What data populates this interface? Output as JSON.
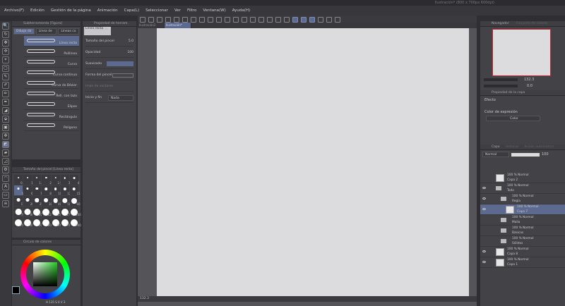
{
  "title": "Ilustración* (800 x 700px 600dpi)",
  "menu": [
    "Archivo(F)",
    "Edición",
    "Gestión de la página",
    "Animación",
    "Capa(L)",
    "Seleccionar",
    "Ver",
    "Filtro",
    "Ventana(W)",
    "Ayuda(H)"
  ],
  "subtool": {
    "header": "Subherramienta [Figura]",
    "tabs": [
      "Dibujo dir",
      "Línea de",
      "Líneas co"
    ],
    "items": [
      "Línea recta",
      "Polilínea",
      "Curva",
      "Curva continua",
      "Curva de Bézier",
      "Rell. con lazo",
      "Elipse",
      "Rectángulo",
      "Polígono"
    ],
    "selected": 0
  },
  "toolprop": {
    "header": "Propiedad de herram. [Línea re",
    "preset": "Línea recta",
    "brush_size_label": "Tamaño del pincel",
    "brush_size": "5.0",
    "opacity_label": "Opacidad",
    "opacity": "100",
    "antialias_label": "Suavizado",
    "shape_label": "Forma del pincel",
    "vector_label": "Imán de vectores",
    "startend_label": "Inicio y fin",
    "startend_value": "Nada"
  },
  "brushsize": {
    "header": "Tamaño del pincel [Línea recta]",
    "sizes": [
      "0.7",
      "1",
      "1.5",
      "2",
      "2.5",
      "3",
      "4",
      "5",
      "6",
      "7",
      "8",
      "10",
      "12",
      "15",
      "17",
      "20",
      "25",
      "30",
      "40",
      "50",
      "60",
      "70",
      "80",
      "100",
      "120",
      "150",
      "170",
      "200",
      "250",
      "300",
      "400",
      "500",
      "600",
      "700",
      "800"
    ],
    "selected": "5"
  },
  "colorwheel": {
    "header": "Círculo de colores",
    "readout": "H 135 S 0 V 3"
  },
  "doc_tabs": [
    "Ilustración2",
    "Ilustración*"
  ],
  "status": {
    "zoom": "132.3"
  },
  "navigator": {
    "tabs": [
      "Navegador",
      "Conjunto de colores"
    ],
    "zoom": "132.3",
    "angle": "0.0"
  },
  "layerprop": {
    "header": "Propiedad de la capa",
    "effect_label": "Efecto",
    "expr_label": "Color de expresión",
    "expr_value": "Color"
  },
  "layers": {
    "tabs": [
      "Capa",
      "Historial",
      "Acción automática"
    ],
    "blend": "Normal",
    "opacity": "100",
    "items": [
      {
        "mode": "100 % Normal",
        "name": "Capa 2",
        "type": "layer",
        "indent": 0,
        "visible": false,
        "selected": false
      },
      {
        "mode": "100 % Normal",
        "name": "Todo",
        "type": "folder",
        "indent": 0,
        "visible": true,
        "selected": false
      },
      {
        "mode": "100 % Normal",
        "name": "Regla",
        "type": "folder",
        "indent": 1,
        "visible": true,
        "selected": false
      },
      {
        "mode": "100 % Normal",
        "name": "Capa 7",
        "type": "layer",
        "indent": 2,
        "visible": true,
        "selected": true
      },
      {
        "mode": "100 % Normal",
        "name": "Malla",
        "type": "folder",
        "indent": 1,
        "visible": false,
        "selected": false
      },
      {
        "mode": "100 % Normal",
        "name": "Básicos",
        "type": "folder",
        "indent": 1,
        "visible": false,
        "selected": false
      },
      {
        "mode": "100 % Normal",
        "name": "Sólidos",
        "type": "folder",
        "indent": 1,
        "visible": false,
        "selected": false
      },
      {
        "mode": "100 % Normal",
        "name": "Capa 8",
        "type": "layer",
        "indent": 0,
        "visible": true,
        "selected": false
      },
      {
        "mode": "100 % Normal",
        "name": "Capa 1",
        "type": "layer",
        "indent": 0,
        "visible": true,
        "selected": false
      }
    ]
  },
  "colors": {
    "accent": "#5d6a90",
    "canvas": "#dcdcdf"
  }
}
